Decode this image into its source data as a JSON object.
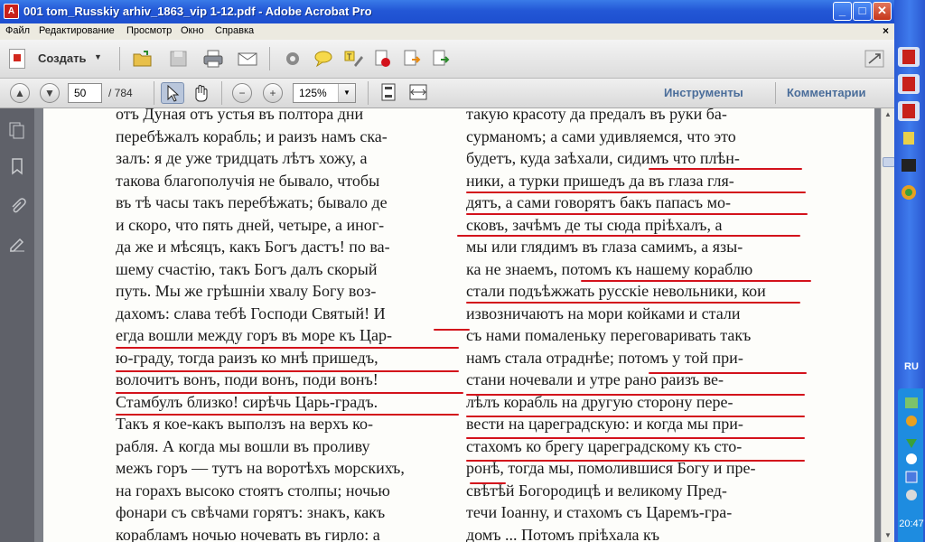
{
  "window": {
    "title": "001 tom_Russkiy arhiv_1863_vip 1-12.pdf - Adobe Acrobat Pro",
    "app_icon_glyph": "A",
    "min_glyph": "_",
    "max_glyph": "□",
    "close_glyph": "✕"
  },
  "menu": {
    "items": [
      "Файл",
      "Редактирование",
      "Просмотр",
      "Окно",
      "Справка"
    ],
    "close_glyph": "×"
  },
  "toolbar": {
    "create_label": "Создать",
    "create_caret": "▼",
    "icons": [
      "open-folder-icon",
      "save-icon",
      "print-icon",
      "email-icon",
      "settings-gear-icon",
      "comment-bubble-icon",
      "highlight-text-icon",
      "delete-page-icon",
      "export-icon",
      "forward-icon"
    ]
  },
  "navigation": {
    "prev_glyph": "▲",
    "next_glyph": "▼",
    "current_page": "50",
    "total_pages": "/ 784",
    "zoom_out_glyph": "−",
    "zoom_in_glyph": "+",
    "zoom": "125%",
    "zoom_caret": "▼",
    "tools_label": "Инструменты",
    "comments_label": "Комментарии"
  },
  "left_pane": {
    "icons": [
      "page-thumbnails-icon",
      "bookmarks-icon",
      "attachments-icon",
      "signatures-icon"
    ]
  },
  "document": {
    "left_column": [
      "отъ Дуная отъ устья въ полтора дни",
      "перебѣжалъ корабль; и раизъ намъ ска-",
      "залъ: я де уже тридцать лѣтъ хожу, а",
      "такова благополучія не бывало, чтобы",
      "въ тѣ часы такъ перебѣжать; бывало де",
      "и скоро, что пять дней, четыре, а иног-",
      "да же и мѣсяцъ, какъ Богъ дастъ! по ва-",
      "шему счастію, такъ Богъ далъ скорый",
      "путь. Мы же грѣшніи хвалу Богу воз-",
      "дахомъ: слава тебѣ Господи Святый! И",
      "егда вошли между горъ въ море къ Цар-",
      "ю-граду, тогда раизъ ко мнѣ пришедъ,",
      "волочитъ вонъ, поди вонъ, поди вонъ!",
      "Стамбулъ близко! сирѣчь Царь-градъ.",
      "Такъ я кое-какъ выползъ на верхъ ко-",
      "рабля. А когда мы вошли въ проливу",
      "межъ горъ — тутъ на воротѣхъ морскихъ,",
      "на горахъ высоко стоятъ столпы; ночью",
      "фонари съ свѣчами горятъ: знакъ, какъ",
      "корабламъ ночью ночевать въ гирло: а"
    ],
    "right_column": [
      "такую красоту да предалъ въ руки ба-",
      "сурманомъ; а сами удивляемся, что это",
      "будетъ, куда заѣхали, сидимъ что плѣн-",
      "ники, а турки пришедъ да въ глаза гля-",
      "дятъ, а сами говорятъ бакъ папасъ мо-",
      "сковъ, зачѣмъ де ты сюда пріѣхалъ, а",
      "мы или глядимъ въ глаза самимъ, а язы-",
      "ка не знаемъ, потомъ къ нашему кораблю",
      "стали подъѣжжать русскіе невольники, кои",
      "извозничаютъ на мори койками и стали",
      "съ нами помаленьку переговаривать такъ",
      "намъ стала отраднѣе; потомъ у той при-",
      "стани ночевали и утре рано раизъ ве-",
      "лѣлъ корабль на другую сторону пере-",
      "вести на цареградскую: и когда мы при-",
      "стахомъ ко брегу цареградскому къ сто-",
      "ронѣ, тогда мы, помолившися Богу и пре-",
      "свѣтѣй Богородицѣ и великому Пред-",
      "течи Іоанну, и стахомъ съ Царемъ-гра-",
      "домъ ... Потомъ пріѣхала къ"
    ]
  },
  "taskbar": {
    "language": "RU",
    "clock": "20:47"
  },
  "colors": {
    "underline": "#d3121b",
    "titlebar": "#2357d6",
    "taskbar": "#3f7bec",
    "link_text": "#4a6d9a"
  }
}
